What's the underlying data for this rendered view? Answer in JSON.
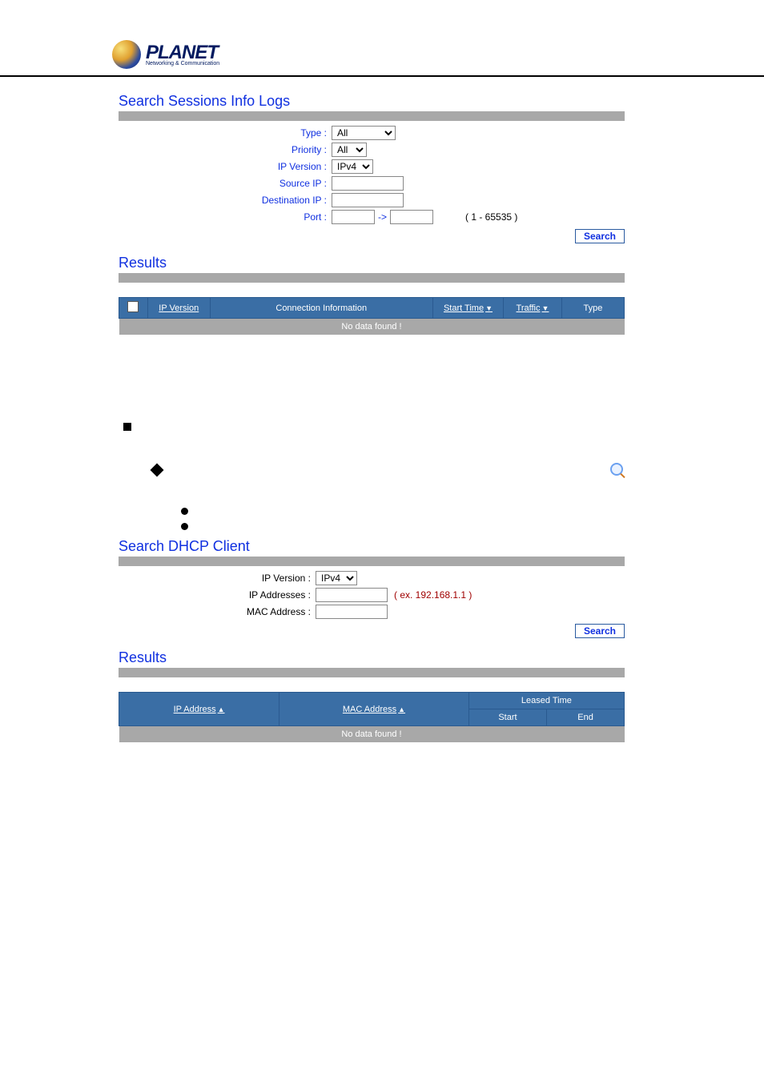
{
  "logo": {
    "brand": "PLANET",
    "tagline": "Networking & Communication"
  },
  "sessions": {
    "title": "Search Sessions Info Logs",
    "labels": {
      "type": "Type :",
      "priority": "Priority :",
      "ip_version": "IP Version :",
      "source_ip": "Source IP :",
      "destination_ip": "Destination IP :",
      "port": "Port :"
    },
    "values": {
      "type": "All",
      "priority": "All",
      "ip_version": "IPv4",
      "source_ip": "",
      "destination_ip": "",
      "port_from": "",
      "port_to": ""
    },
    "port_hint": "( 1 - 65535 )",
    "search_btn": "Search",
    "results_title": "Results",
    "columns": {
      "ip_version": "IP Version",
      "connection_info": "Connection Information",
      "start_time": "Start Time",
      "traffic": "Traffic",
      "type": "Type"
    },
    "no_data": "No data found !"
  },
  "dhcp": {
    "title": "Search DHCP Client",
    "labels": {
      "ip_version": "IP Version :",
      "ip_addresses": "IP Addresses :",
      "mac_address": "MAC Address :"
    },
    "values": {
      "ip_version": "IPv4",
      "ip_addresses": "",
      "mac_address": ""
    },
    "ip_hint": "( ex. 192.168.1.1 )",
    "search_btn": "Search",
    "results_title": "Results",
    "columns": {
      "ip_address": "IP Address",
      "mac_address": "MAC Address",
      "leased_time": "Leased Time",
      "start": "Start",
      "end": "End"
    },
    "no_data": "No data found !"
  }
}
